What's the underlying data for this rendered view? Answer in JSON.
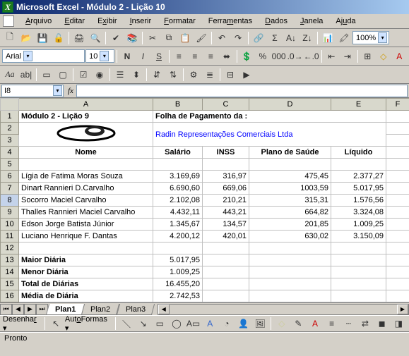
{
  "window": {
    "title": "Microsoft Excel - Módulo 2 - Lição 10"
  },
  "menu": {
    "file": "Arquivo",
    "edit": "Editar",
    "view": "Exibir",
    "insert": "Inserir",
    "format": "Formatar",
    "tools": "Ferramentas",
    "data": "Dados",
    "window": "Janela",
    "help": "Ajuda"
  },
  "font": {
    "name": "Arial",
    "size": "10"
  },
  "zoom": "100%",
  "namebox": "I8",
  "columns": {
    "A": "A",
    "B": "B",
    "C": "C",
    "D": "D",
    "E": "E",
    "F": "F"
  },
  "rows": [
    "1",
    "2",
    "3",
    "4",
    "5",
    "6",
    "7",
    "8",
    "9",
    "10",
    "11",
    "12",
    "13",
    "14",
    "15",
    "16"
  ],
  "cells": {
    "A1": "Módulo 2 - Lição 9",
    "B1": "Folha de Pagamento da :",
    "B2": "Radin Representações Comerciais Ltda",
    "A4": "Nome",
    "B4": "Salário",
    "C4": "INSS",
    "D4": "Plano de Saúde",
    "E4": "Líquido",
    "A6": "Lígia de Fatima Moras Souza",
    "B6": "3.169,69",
    "C6": "316,97",
    "D6": "475,45",
    "E6": "2.377,27",
    "A7": "Dinart Rannieri D.Carvalho",
    "B7": "6.690,60",
    "C7": "669,06",
    "D7": "1003,59",
    "E7": "5.017,95",
    "A8": "Socorro Maciel Carvalho",
    "B8": "2.102,08",
    "C8": "210,21",
    "D8": "315,31",
    "E8": "1.576,56",
    "A9": "Thalles Rannieri Maciel Carvalho",
    "B9": "4.432,11",
    "C9": "443,21",
    "D9": "664,82",
    "E9": "3.324,08",
    "A10": "Edson Jorge Batista Júnior",
    "B10": "1.345,67",
    "C10": "134,57",
    "D10": "201,85",
    "E10": "1.009,25",
    "A11": "Luciano Henrique F. Dantas",
    "B11": "4.200,12",
    "C11": "420,01",
    "D11": "630,02",
    "E11": "3.150,09",
    "A13": "Maior Diária",
    "B13": "5.017,95",
    "A14": "Menor Diária",
    "B14": "1.009,25",
    "A15": "Total de Diárias",
    "B15": "16.455,20",
    "A16": "Média de Diária",
    "B16": "2.742,53"
  },
  "tabs": {
    "t1": "Plan1",
    "t2": "Plan2",
    "t3": "Plan3"
  },
  "draw": {
    "label": "Desenhar",
    "autoshapes": "AutoFormas"
  },
  "status": "Pronto"
}
